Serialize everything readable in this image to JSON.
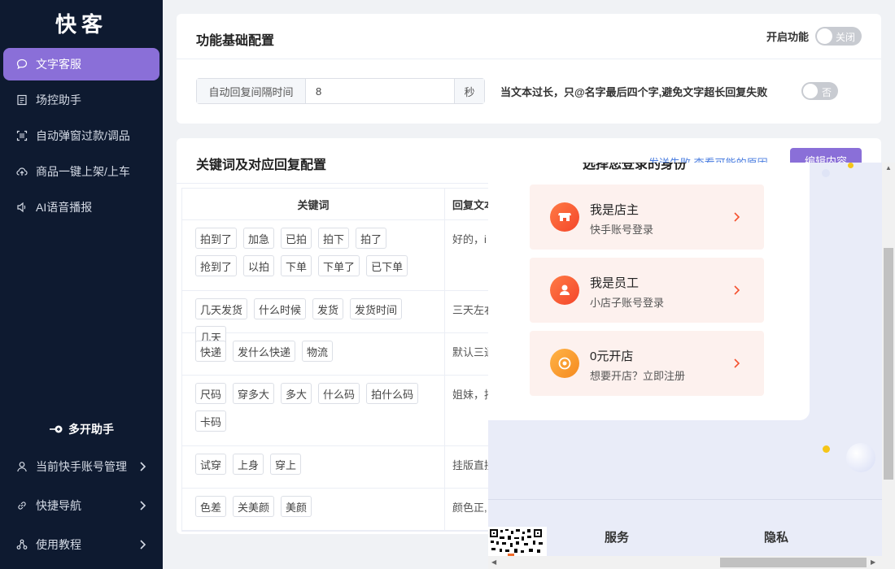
{
  "sidebar": {
    "logo": "快客",
    "items": [
      {
        "label": "文字客服",
        "icon": "chat-icon",
        "active": true
      },
      {
        "label": "场控助手",
        "icon": "document-icon"
      },
      {
        "label": "自动弹窗过款/调品",
        "icon": "scan-icon"
      },
      {
        "label": "商品一键上架/上车",
        "icon": "upload-cloud-icon"
      },
      {
        "label": "AI语音播报",
        "icon": "speaker-icon"
      }
    ],
    "multi_helper": "多开助手",
    "bottom": [
      {
        "label": "当前快手账号管理",
        "icon": "user-icon"
      },
      {
        "label": "快捷导航",
        "icon": "link-icon"
      },
      {
        "label": "使用教程",
        "icon": "tutorial-icon"
      }
    ],
    "accent": "#8a6fd8"
  },
  "basic_config": {
    "title": "功能基础配置",
    "enable_label": "开启功能",
    "enable_switch_text": "关闭",
    "interval_label": "自动回复间隔时间",
    "interval_value": "8",
    "interval_unit": "秒",
    "long_text_label": "当文本过长，只@名字最后四个字,避免文字超长回复失败",
    "long_text_switch_text": "否"
  },
  "keyword_config": {
    "title": "关键词及对应回复配置",
    "send_fail_link": "发送失败 查看可能的原因",
    "edit_button": "编辑内容",
    "columns": [
      "关键词",
      "回复文本"
    ],
    "rows": [
      {
        "keywords": [
          "拍到了",
          "加急",
          "已拍",
          "拍下",
          "拍了",
          "抢到了",
          "以拍",
          "下单",
          "下单了",
          "已下单"
        ],
        "reply": "好的，i"
      },
      {
        "keywords": [
          "几天发货",
          "什么时候",
          "发货",
          "发货时间",
          "几天"
        ],
        "reply": "三天左右"
      },
      {
        "keywords": [
          "快递",
          "发什么快递",
          "物流"
        ],
        "reply": "默认三通"
      },
      {
        "keywords": [
          "尺码",
          "穿多大",
          "多大",
          "什么码",
          "拍什么码",
          "卡码"
        ],
        "reply": "姐妹，按"
      },
      {
        "keywords": [
          "试穿",
          "上身",
          "穿上"
        ],
        "reply": "挂版直接"
      },
      {
        "keywords": [
          "色差",
          "关美颜",
          "美颜"
        ],
        "reply": "颜色正,"
      }
    ]
  },
  "login_popup": {
    "title": "选择您登录的身份",
    "roles": [
      {
        "title": "我是店主",
        "subtitle": "快手账号登录",
        "icon": "shop-icon"
      },
      {
        "title": "我是员工",
        "subtitle": "小店子账号登录",
        "icon": "person-icon"
      },
      {
        "title": "0元开店",
        "subtitle": "想要开店？立即注册",
        "icon": "coin-icon"
      }
    ],
    "footer_links": [
      "服务",
      "隐私"
    ]
  }
}
